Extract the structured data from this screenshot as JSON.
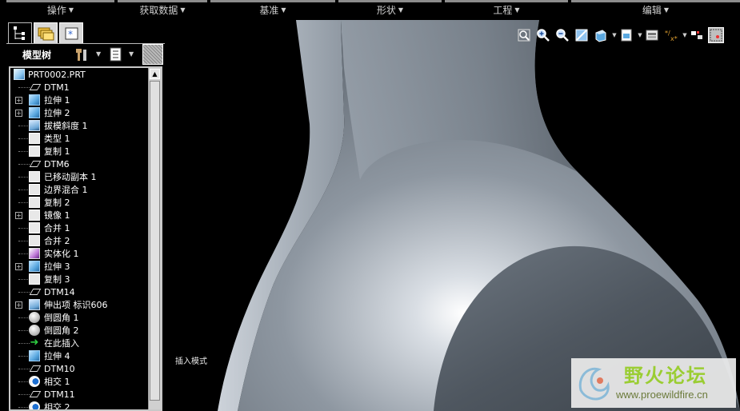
{
  "menu": {
    "items": [
      {
        "label": "操作"
      },
      {
        "label": "获取数据"
      },
      {
        "label": "基准"
      },
      {
        "label": "形状"
      },
      {
        "label": "工程"
      },
      {
        "label": "编辑"
      }
    ]
  },
  "panel": {
    "title": "模型树",
    "tabs": [
      "model-tree-tab",
      "folder-browser-tab",
      "favorites-tab"
    ]
  },
  "tree": {
    "root": "PRT0002.PRT",
    "items": [
      {
        "label": "DTM1",
        "icon": "datum-plane-icon",
        "expandable": false
      },
      {
        "label": "拉伸 1",
        "icon": "extrude-icon",
        "expandable": true
      },
      {
        "label": "拉伸 2",
        "icon": "extrude-icon",
        "expandable": true
      },
      {
        "label": "拔模斜度 1",
        "icon": "draft-icon",
        "expandable": false
      },
      {
        "label": "类型 1",
        "icon": "surface-icon",
        "expandable": false
      },
      {
        "label": "复制 1",
        "icon": "copy-icon",
        "expandable": false
      },
      {
        "label": "DTM6",
        "icon": "datum-plane-icon",
        "expandable": false
      },
      {
        "label": "已移动副本 1",
        "icon": "copy-icon",
        "expandable": false
      },
      {
        "label": "边界混合 1",
        "icon": "surface-icon",
        "expandable": false
      },
      {
        "label": "复制 2",
        "icon": "copy-icon",
        "expandable": false
      },
      {
        "label": "镜像 1",
        "icon": "mirror-icon",
        "expandable": true
      },
      {
        "label": "合并 1",
        "icon": "merge-icon",
        "expandable": false
      },
      {
        "label": "合并 2",
        "icon": "merge-icon",
        "expandable": false
      },
      {
        "label": "实体化 1",
        "icon": "solidify-icon",
        "expandable": false
      },
      {
        "label": "拉伸 3",
        "icon": "extrude-icon",
        "expandable": true
      },
      {
        "label": "复制 3",
        "icon": "copy-icon",
        "expandable": false
      },
      {
        "label": "DTM14",
        "icon": "datum-plane-icon",
        "expandable": false
      },
      {
        "label": "伸出项 标识606",
        "icon": "protrusion-icon",
        "expandable": true
      },
      {
        "label": "倒圆角 1",
        "icon": "round-icon",
        "expandable": false
      },
      {
        "label": "倒圆角 2",
        "icon": "round-icon",
        "expandable": false
      },
      {
        "label": "在此插入",
        "icon": "insert-here-icon",
        "expandable": false
      },
      {
        "label": "拉伸 4",
        "icon": "extrude-icon",
        "expandable": false
      },
      {
        "label": "DTM10",
        "icon": "datum-plane-icon",
        "expandable": false
      },
      {
        "label": "相交 1",
        "icon": "intersect-icon",
        "expandable": false
      },
      {
        "label": "DTM11",
        "icon": "datum-plane-icon",
        "expandable": false
      },
      {
        "label": "相交 2",
        "icon": "intersect-icon",
        "expandable": false
      }
    ]
  },
  "viewport": {
    "mode_label": "插入模式",
    "toolbar": [
      "refit-icon",
      "zoom-in-icon",
      "zoom-out-icon",
      "repaint-icon",
      "shading-icon",
      "saved-views-icon",
      "layers-icon",
      "datum-display-icon",
      "spin-center-icon",
      "selection-filter-icon"
    ]
  },
  "watermark": {
    "title": "野火论坛",
    "url": "www.proewildfire.cn"
  }
}
